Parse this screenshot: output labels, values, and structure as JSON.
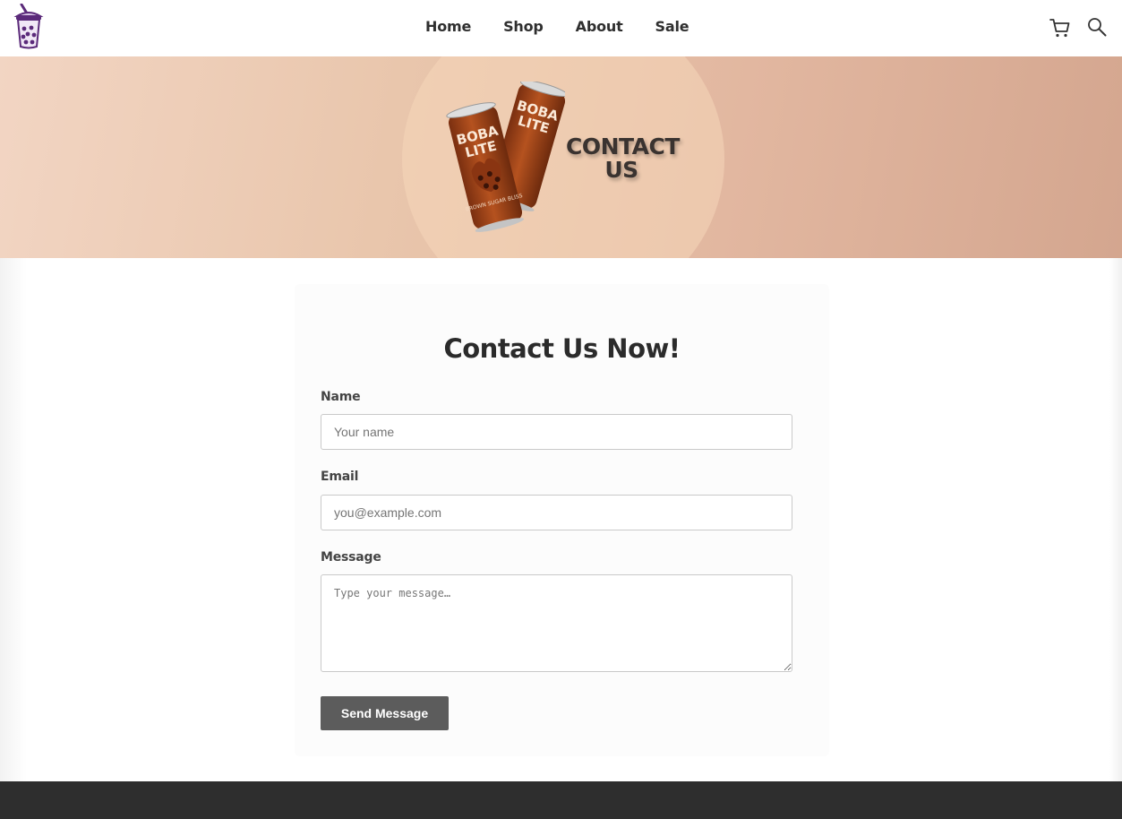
{
  "nav": {
    "logo_icon": "boba-cup-logo",
    "links": [
      "Home",
      "Shop",
      "About",
      "Sale"
    ],
    "icons": [
      "cart-icon",
      "search-icon"
    ]
  },
  "hero": {
    "can_text_top": "BOBA",
    "can_text_bottom": "LITE",
    "can_flavor": "BROWN SUGAR BLISS",
    "title_line1": "CONTACT",
    "title_line2": "US"
  },
  "form": {
    "heading": "Contact Us Now!",
    "name": {
      "label": "Name",
      "placeholder": "Your name"
    },
    "email": {
      "label": "Email",
      "placeholder": "you@example.com"
    },
    "message": {
      "label": "Message",
      "placeholder": "Type your message…"
    },
    "submit_label": "Send Message"
  },
  "colors": {
    "brand_purple": "#5b2a7a",
    "button": "#5c5c5c",
    "footer": "#2e2e2e",
    "can": "#a4471f"
  }
}
